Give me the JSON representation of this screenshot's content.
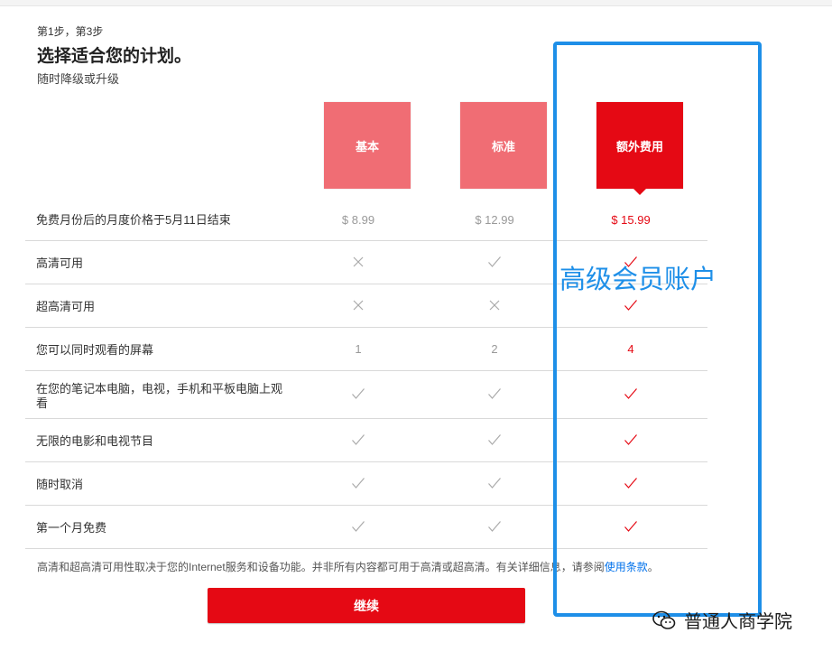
{
  "header": {
    "step": "第1步，第3步",
    "title": "选择适合您的计划。",
    "subtitle": "随时降级或升级"
  },
  "plans": [
    {
      "name": "基本",
      "selected": false
    },
    {
      "name": "标准",
      "selected": false
    },
    {
      "name": "额外费用",
      "selected": true
    }
  ],
  "rows": [
    {
      "label": "免费月份后的月度价格于5月11日结束",
      "values": [
        "$ 8.99",
        "$ 12.99",
        "$ 15.99"
      ]
    },
    {
      "label": "高清可用",
      "values": [
        "x",
        "check",
        "check"
      ]
    },
    {
      "label": "超高清可用",
      "values": [
        "x",
        "x",
        "check"
      ]
    },
    {
      "label": "您可以同时观看的屏幕",
      "values": [
        "1",
        "2",
        "4"
      ]
    },
    {
      "label": "在您的笔记本电脑，电视，手机和平板电脑上观看",
      "values": [
        "check",
        "check",
        "check"
      ]
    },
    {
      "label": "无限的电影和电视节目",
      "values": [
        "check",
        "check",
        "check"
      ]
    },
    {
      "label": "随时取消",
      "values": [
        "check",
        "check",
        "check"
      ]
    },
    {
      "label": "第一个月免费",
      "values": [
        "check",
        "check",
        "check"
      ]
    }
  ],
  "footnote": {
    "text": "高清和超高清可用性取决于您的Internet服务和设备功能。并非所有内容都可用于高清或超高清。有关详细信息，请参阅",
    "link": "使用条款",
    "end": "。"
  },
  "continue_label": "继续",
  "annotation": "高级会员账户",
  "watermark": "普通人商学院",
  "colors": {
    "accent": "#e50914",
    "plan_unselected": "#f06d74",
    "annotation": "#1e8fe8"
  }
}
